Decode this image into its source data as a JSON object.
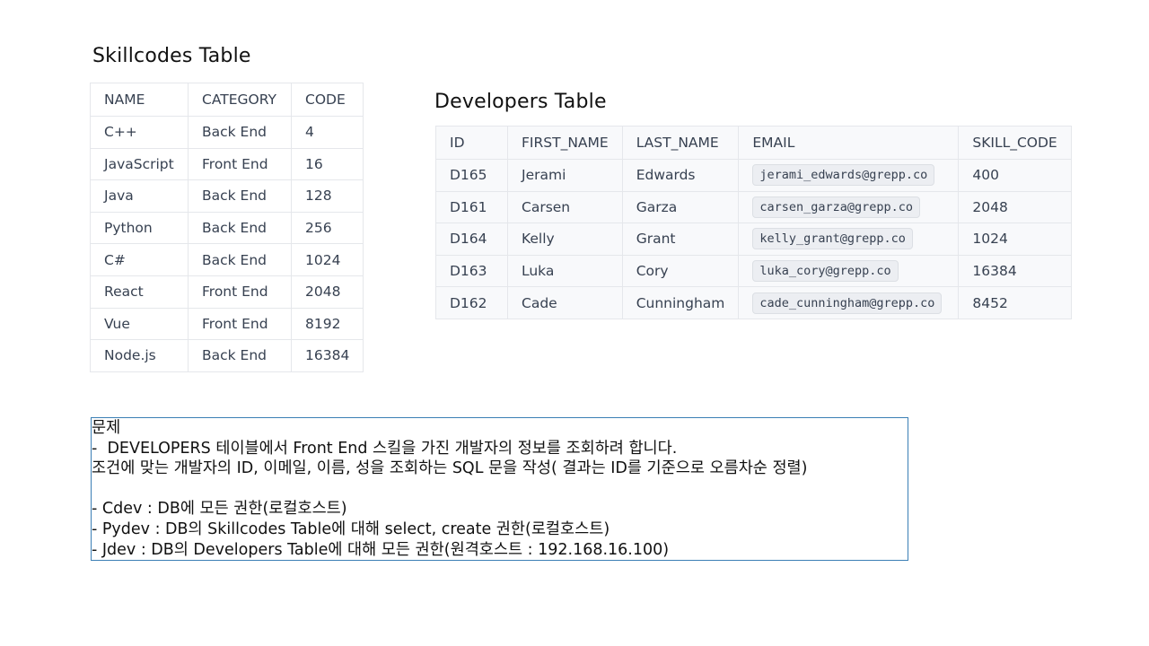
{
  "skillcodes": {
    "title": "Skillcodes Table",
    "headers": [
      "NAME",
      "CATEGORY",
      "CODE"
    ],
    "rows": [
      [
        "C++",
        "Back End",
        "4"
      ],
      [
        "JavaScript",
        "Front End",
        "16"
      ],
      [
        "Java",
        "Back End",
        "128"
      ],
      [
        "Python",
        "Back End",
        "256"
      ],
      [
        "C#",
        "Back End",
        "1024"
      ],
      [
        "React",
        "Front End",
        "2048"
      ],
      [
        "Vue",
        "Front End",
        "8192"
      ],
      [
        "Node.js",
        "Back End",
        "16384"
      ]
    ]
  },
  "developers": {
    "title": "Developers Table",
    "headers": [
      "ID",
      "FIRST_NAME",
      "LAST_NAME",
      "EMAIL",
      "SKILL_CODE"
    ],
    "rows": [
      [
        "D165",
        "Jerami",
        "Edwards",
        "jerami_edwards@grepp.co",
        "400"
      ],
      [
        "D161",
        "Carsen",
        "Garza",
        "carsen_garza@grepp.co",
        "2048"
      ],
      [
        "D164",
        "Kelly",
        "Grant",
        "kelly_grant@grepp.co",
        "1024"
      ],
      [
        "D163",
        "Luka",
        "Cory",
        "luka_cory@grepp.co",
        "16384"
      ],
      [
        "D162",
        "Cade",
        "Cunningham",
        "cade_cunningham@grepp.co",
        "8452"
      ]
    ]
  },
  "problem": {
    "lines": [
      "문제",
      "-  DEVELOPERS 테이블에서 Front End 스킬을 가진 개발자의 정보를 조회하려 합니다.",
      "조건에 맞는 개발자의 ID, 이메일, 이름, 성을 조회하는 SQL 문을 작성( 결과는 ID를 기준으로 오름차순 정렬)",
      "",
      "- Cdev : DB에 모든 권한(로컬호스트)",
      "- Pydev : DB의 Skillcodes Table에 대해 select, create 권한(로컬호스트)",
      "- Jdev : DB의 Developers Table에 대해 모든 권한(원격호스트 : 192.168.16.100)"
    ]
  },
  "colors": {
    "box_border": "#3b7fb5",
    "table_border": "#e5e7eb",
    "chip_background": "#eceef2"
  }
}
